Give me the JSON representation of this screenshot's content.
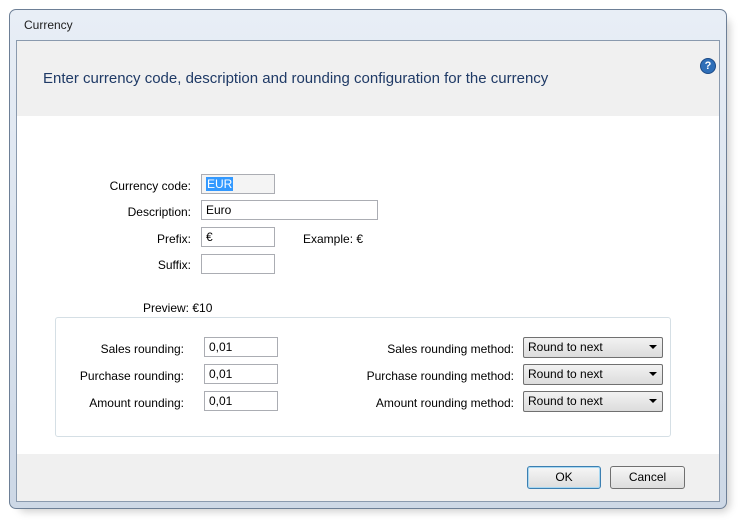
{
  "window": {
    "title": "Currency"
  },
  "header": {
    "text": "Enter currency code, description and rounding configuration for the currency"
  },
  "form": {
    "currency_code_label": "Currency code:",
    "currency_code_value": "EUR",
    "description_label": "Description:",
    "description_value": "Euro",
    "prefix_label": "Prefix:",
    "prefix_value": "€",
    "example_text": "Example: €",
    "suffix_label": "Suffix:",
    "suffix_value": "",
    "preview_text": "Preview: €10"
  },
  "rounding": {
    "sales_label": "Sales rounding:",
    "sales_value": "0,01",
    "purchase_label": "Purchase rounding:",
    "purchase_value": "0,01",
    "amount_label": "Amount rounding:",
    "amount_value": "0,01",
    "sales_method_label": "Sales rounding method:",
    "sales_method_value": "Round to next",
    "purchase_method_label": "Purchase rounding method:",
    "purchase_method_value": "Round to next",
    "amount_method_label": "Amount rounding method:",
    "amount_method_value": "Round to next"
  },
  "buttons": {
    "ok": "OK",
    "cancel": "Cancel"
  },
  "icons": {
    "help": "help-icon",
    "dropdown": "chevron-down-icon"
  },
  "colors": {
    "header_text": "#1f3a66",
    "selection": "#3399ff",
    "help_icon": "#2f6fb8"
  }
}
